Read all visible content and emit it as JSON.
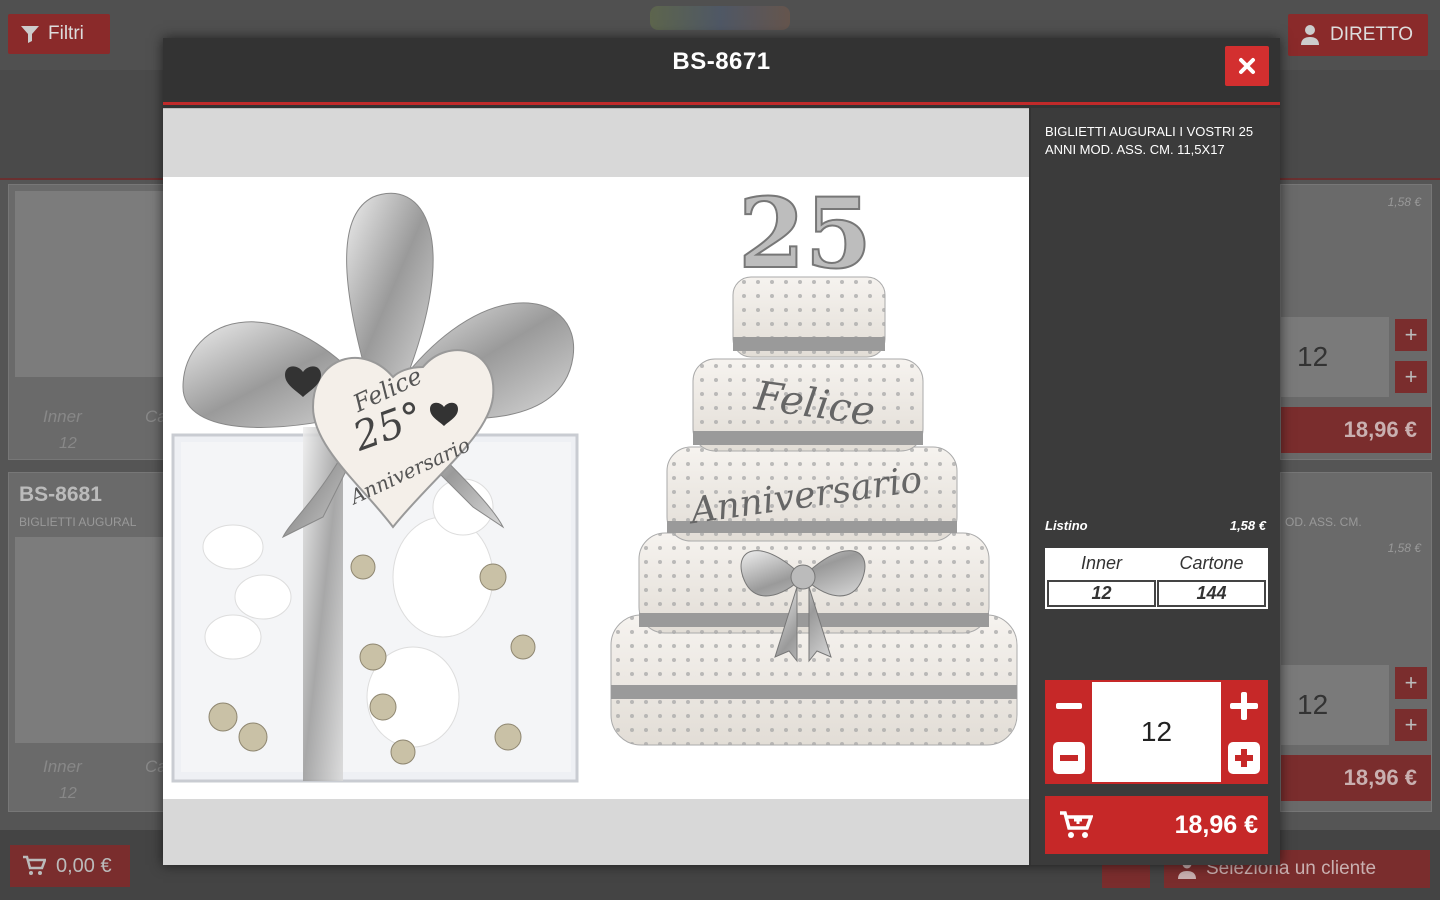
{
  "topbar": {
    "filter_label": "Filtri",
    "direct_label": "DIRETTO"
  },
  "bg_cards": {
    "inner_label": "Inner",
    "cartone_short": "Ca",
    "inner_value": "12",
    "second_code": "BS-8681",
    "second_desc": "BIGLIETTI AUGURAL",
    "right_desc": "OD. ASS. CM.",
    "price_small": "1,58 €",
    "qty": "12",
    "total": "18,96 €"
  },
  "bottombar": {
    "cart_total": "0,00 €",
    "client_label": "Seleziona un cliente"
  },
  "modal": {
    "title": "BS-8671",
    "description": "BIGLIETTI AUGURALI I VOSTRI 25 ANNI MOD. ASS. CM. 11,5X17",
    "listino_label": "Listino",
    "listino_value": "1,58 €",
    "pack": {
      "inner_label": "Inner",
      "cartone_label": "Cartone",
      "inner_value": "12",
      "cartone_value": "144"
    },
    "quantity": "12",
    "cart_total": "18,96 €",
    "image_text": {
      "heart_line1": "Felice",
      "heart_number": "25°",
      "heart_line2": "Anniversario",
      "cake_number": "25",
      "cake_line1": "Felice",
      "cake_line2": "Anniversario"
    }
  },
  "colors": {
    "accent": "#c62828",
    "modal_bg": "#333333",
    "side_bg": "#3b3b3b"
  }
}
